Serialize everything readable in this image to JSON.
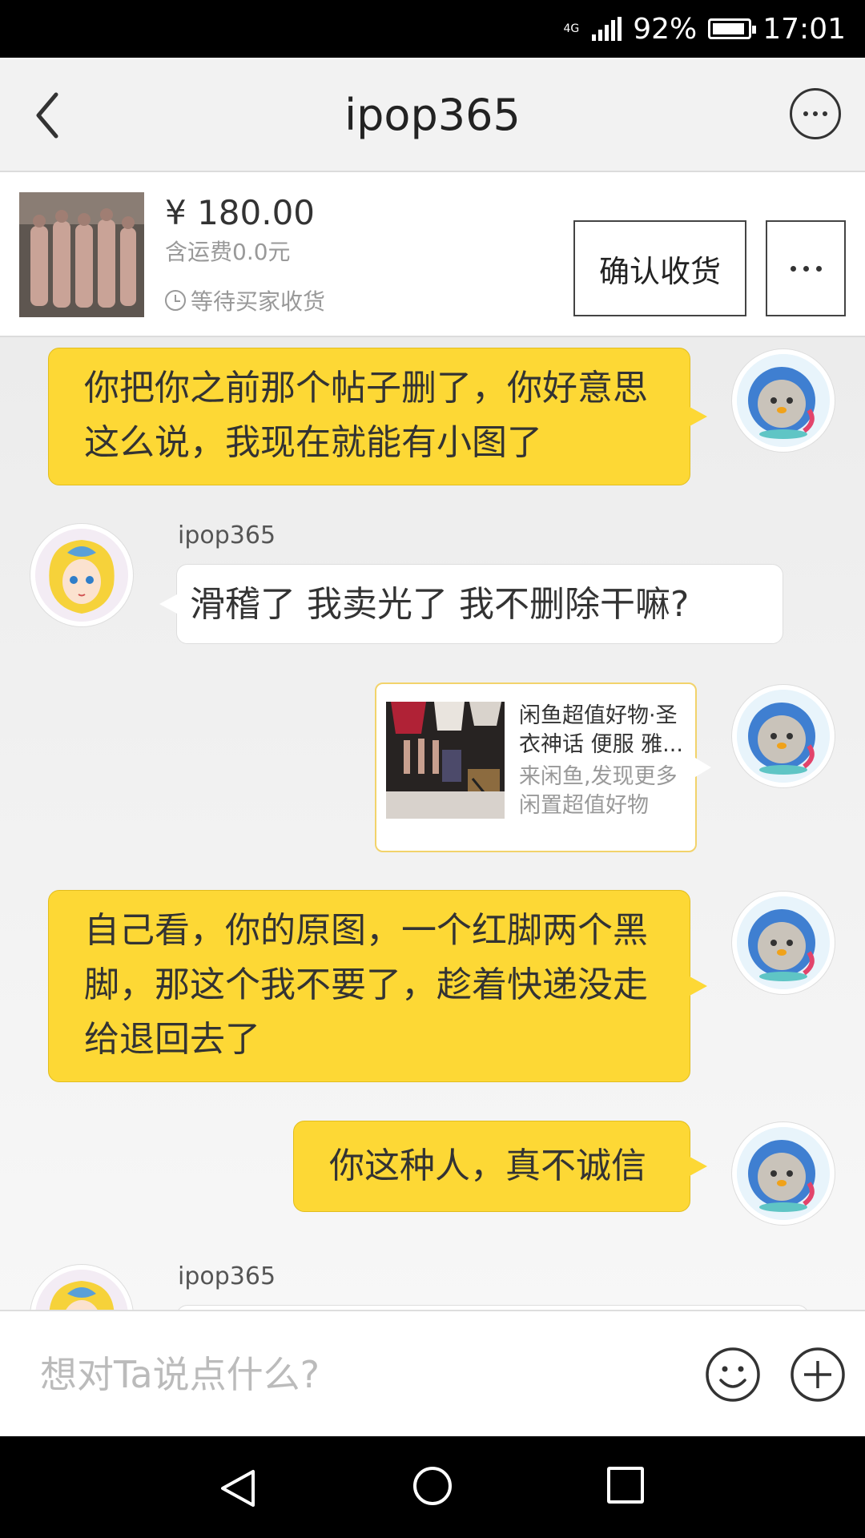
{
  "status_bar": {
    "network": "4G",
    "battery": "92%",
    "battery_level": 0.92,
    "time": "17:01"
  },
  "header": {
    "title": "ipop365"
  },
  "product": {
    "price": "¥ 180.00",
    "shipping": "含运费0.0元",
    "status": "等待买家收货",
    "confirm_label": "确认收货"
  },
  "messages": [
    {
      "side": "right",
      "text": "你把你之前那个帖子删了，你好意思这么说，我现在就能有小图了"
    },
    {
      "side": "left",
      "sender": "ipop365",
      "text": "滑稽了 我卖光了 我不删除干嘛?"
    },
    {
      "side": "right",
      "type": "link",
      "title": "闲鱼超值好物·圣衣神话 便服 雅...",
      "description": "来闲鱼,发现更多闲置超值好物"
    },
    {
      "side": "right",
      "text": "自己看，你的原图，一个红脚两个黑脚，那这个我不要了，趁着快递没走给退回去了"
    },
    {
      "side": "right",
      "text": "你这种人，真不诚信"
    },
    {
      "side": "left",
      "sender": "ipop365",
      "text": ""
    }
  ],
  "input": {
    "placeholder": "想对Ta说点什么?"
  },
  "icons": {
    "back": "back-arrow-icon",
    "more": "more-icon",
    "clock": "clock-icon",
    "emoji": "emoji-icon",
    "plus": "plus-icon",
    "nav": [
      "nav-back-icon",
      "nav-home-icon",
      "nav-recent-icon"
    ]
  },
  "colors": {
    "bubble_self": "#fdd835",
    "bubble_other": "#ffffff",
    "link_border": "#f2d36b"
  }
}
